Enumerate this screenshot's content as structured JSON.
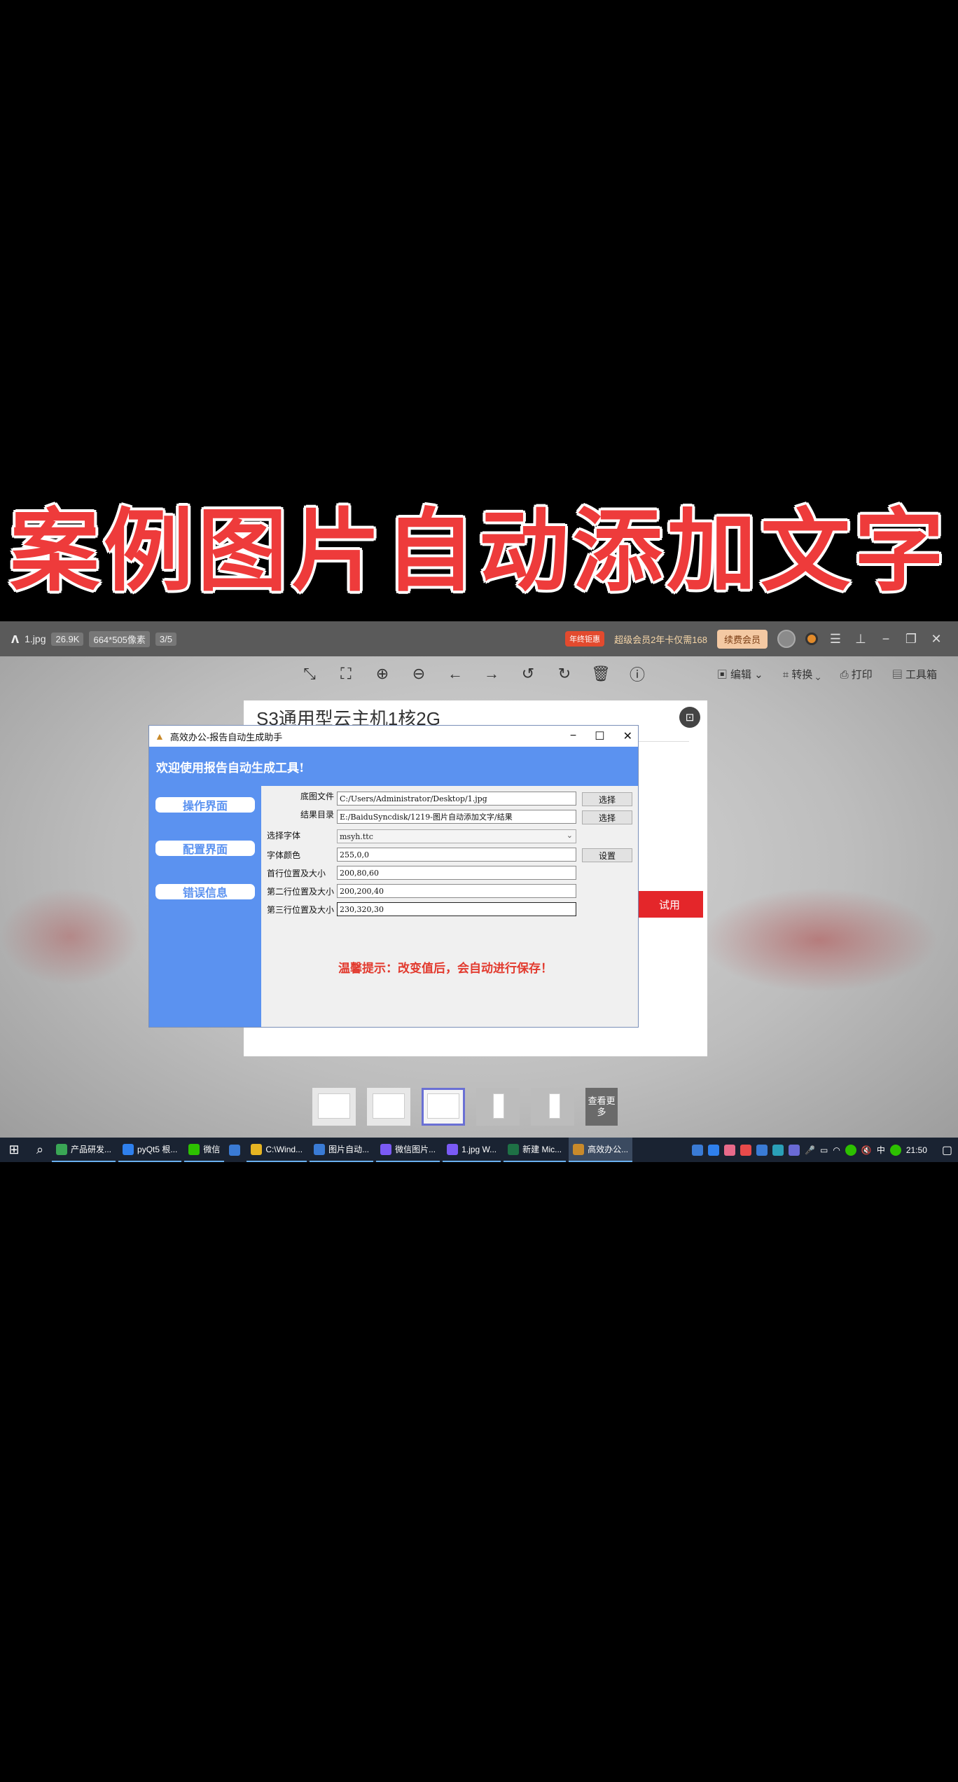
{
  "caption": "案例图片自动添加文字",
  "viewer": {
    "file_name": "1.jpg",
    "file_size": "26.9K",
    "dimensions": "664*505像素",
    "page_index": "3/5",
    "vip_tag": "年终钜惠",
    "vip_text": "超级会员2年卡仅需168",
    "renew_label": "续费会员",
    "toolbar_right": {
      "edit": "编辑",
      "convert": "转换",
      "print": "打印",
      "toolbox": "工具箱"
    },
    "more_label": "查看更多"
  },
  "document": {
    "heading": "S3通用型云主机1核2G",
    "red_button": "试用"
  },
  "app": {
    "title": "高效办公-报告自动生成助手",
    "banner": "欢迎使用报告自动生成工具!",
    "sidebar": [
      "操作界面",
      "配置界面",
      "错误信息"
    ],
    "fields": {
      "base_image": {
        "label": "底图文件",
        "value": "C:/Users/Administrator/Desktop/1.jpg",
        "button": "选择"
      },
      "result_dir": {
        "label": "结果目录",
        "value": "E:/BaiduSyncdisk/1219-图片自动添加文字/结果",
        "button": "选择"
      },
      "font": {
        "label": "选择字体",
        "value": "msyh.ttc"
      },
      "font_color": {
        "label": "字体颜色",
        "value": "255,0,0",
        "button": "设置"
      },
      "line1": {
        "label": "首行位置及大小",
        "value": "200,80,60"
      },
      "line2": {
        "label": "第二行位置及大小",
        "value": "200,200,40"
      },
      "line3": {
        "label": "第三行位置及大小",
        "value": "230,320,30"
      }
    },
    "tip": "温馨提示：改变值后，会自动进行保存！"
  },
  "taskbar": {
    "apps": [
      {
        "label": "产品研发...",
        "color": "#3aa655"
      },
      {
        "label": "pyQt5 根...",
        "color": "#2f80ed"
      },
      {
        "label": "微信",
        "color": "#2dc100"
      },
      {
        "label": "C:\\Wind...",
        "color": "#e6b422"
      },
      {
        "label": "图片自动...",
        "color": "#3a7bd5"
      },
      {
        "label": "微信图片...",
        "color": "#7a5af5"
      },
      {
        "label": "1.jpg  W...",
        "color": "#7a5af5"
      },
      {
        "label": "新建 Mic...",
        "color": "#1e7145"
      },
      {
        "label": "高效办公...",
        "color": "#c98a2a"
      }
    ],
    "ime": "中",
    "time": "21:50"
  }
}
